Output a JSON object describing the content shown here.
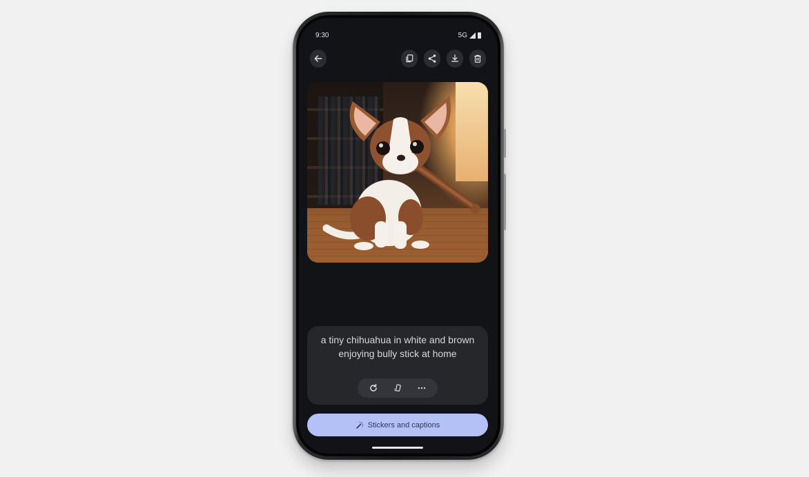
{
  "status_bar": {
    "time": "9:30",
    "network": "5G",
    "signal_icon": "signal-icon",
    "battery_icon": "battery-icon"
  },
  "toolbar": {
    "back": {
      "icon": "arrow-left-icon",
      "label": "Back"
    },
    "actions": [
      {
        "icon": "copy-icon",
        "label": "Copy"
      },
      {
        "icon": "share-icon",
        "label": "Share"
      },
      {
        "icon": "download-icon",
        "label": "Download"
      },
      {
        "icon": "delete-icon",
        "label": "Delete"
      }
    ]
  },
  "image": {
    "description": "AI-generated image of a tiny white and brown chihuahua puppy sitting on a wooden floor holding a bully stick in its mouth, bookshelf and warm window light in background"
  },
  "prompt": {
    "text": "a tiny chihuahua in white and brown enjoying bully stick at home",
    "actions": [
      {
        "icon": "refresh-icon",
        "label": "Regenerate"
      },
      {
        "icon": "phone-rotate-icon",
        "label": "Set as wallpaper"
      },
      {
        "icon": "more-horizontal-icon",
        "label": "More"
      }
    ]
  },
  "primary_action": {
    "icon": "magic-wand-icon",
    "label": "Stickers and captions"
  },
  "colors": {
    "background": "#f1f1f1",
    "screen": "#121316",
    "card": "#25272b",
    "accent_button": "#b3c1f7",
    "accent_text": "#2d3660"
  }
}
